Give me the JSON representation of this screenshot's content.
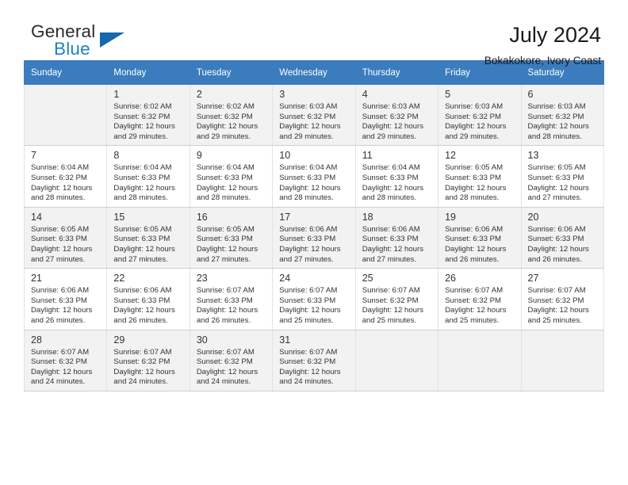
{
  "brand": {
    "name_top": "General",
    "name_bottom": "Blue",
    "accent_color": "#1f7fc4",
    "triangle_color": "#1667ad"
  },
  "header": {
    "title": "July 2024",
    "subtitle": "Bokakokore, Ivory Coast"
  },
  "calendar": {
    "header_bg": "#3a7cbe",
    "header_text_color": "#ffffff",
    "weekdays": [
      "Sunday",
      "Monday",
      "Tuesday",
      "Wednesday",
      "Thursday",
      "Friday",
      "Saturday"
    ],
    "weeks": [
      {
        "shaded": true,
        "days": [
          {
            "num": "",
            "lines": []
          },
          {
            "num": "1",
            "lines": [
              "Sunrise: 6:02 AM",
              "Sunset: 6:32 PM",
              "Daylight: 12 hours",
              "and 29 minutes."
            ]
          },
          {
            "num": "2",
            "lines": [
              "Sunrise: 6:02 AM",
              "Sunset: 6:32 PM",
              "Daylight: 12 hours",
              "and 29 minutes."
            ]
          },
          {
            "num": "3",
            "lines": [
              "Sunrise: 6:03 AM",
              "Sunset: 6:32 PM",
              "Daylight: 12 hours",
              "and 29 minutes."
            ]
          },
          {
            "num": "4",
            "lines": [
              "Sunrise: 6:03 AM",
              "Sunset: 6:32 PM",
              "Daylight: 12 hours",
              "and 29 minutes."
            ]
          },
          {
            "num": "5",
            "lines": [
              "Sunrise: 6:03 AM",
              "Sunset: 6:32 PM",
              "Daylight: 12 hours",
              "and 29 minutes."
            ]
          },
          {
            "num": "6",
            "lines": [
              "Sunrise: 6:03 AM",
              "Sunset: 6:32 PM",
              "Daylight: 12 hours",
              "and 28 minutes."
            ]
          }
        ]
      },
      {
        "shaded": false,
        "days": [
          {
            "num": "7",
            "lines": [
              "Sunrise: 6:04 AM",
              "Sunset: 6:32 PM",
              "Daylight: 12 hours",
              "and 28 minutes."
            ]
          },
          {
            "num": "8",
            "lines": [
              "Sunrise: 6:04 AM",
              "Sunset: 6:33 PM",
              "Daylight: 12 hours",
              "and 28 minutes."
            ]
          },
          {
            "num": "9",
            "lines": [
              "Sunrise: 6:04 AM",
              "Sunset: 6:33 PM",
              "Daylight: 12 hours",
              "and 28 minutes."
            ]
          },
          {
            "num": "10",
            "lines": [
              "Sunrise: 6:04 AM",
              "Sunset: 6:33 PM",
              "Daylight: 12 hours",
              "and 28 minutes."
            ]
          },
          {
            "num": "11",
            "lines": [
              "Sunrise: 6:04 AM",
              "Sunset: 6:33 PM",
              "Daylight: 12 hours",
              "and 28 minutes."
            ]
          },
          {
            "num": "12",
            "lines": [
              "Sunrise: 6:05 AM",
              "Sunset: 6:33 PM",
              "Daylight: 12 hours",
              "and 28 minutes."
            ]
          },
          {
            "num": "13",
            "lines": [
              "Sunrise: 6:05 AM",
              "Sunset: 6:33 PM",
              "Daylight: 12 hours",
              "and 27 minutes."
            ]
          }
        ]
      },
      {
        "shaded": true,
        "days": [
          {
            "num": "14",
            "lines": [
              "Sunrise: 6:05 AM",
              "Sunset: 6:33 PM",
              "Daylight: 12 hours",
              "and 27 minutes."
            ]
          },
          {
            "num": "15",
            "lines": [
              "Sunrise: 6:05 AM",
              "Sunset: 6:33 PM",
              "Daylight: 12 hours",
              "and 27 minutes."
            ]
          },
          {
            "num": "16",
            "lines": [
              "Sunrise: 6:05 AM",
              "Sunset: 6:33 PM",
              "Daylight: 12 hours",
              "and 27 minutes."
            ]
          },
          {
            "num": "17",
            "lines": [
              "Sunrise: 6:06 AM",
              "Sunset: 6:33 PM",
              "Daylight: 12 hours",
              "and 27 minutes."
            ]
          },
          {
            "num": "18",
            "lines": [
              "Sunrise: 6:06 AM",
              "Sunset: 6:33 PM",
              "Daylight: 12 hours",
              "and 27 minutes."
            ]
          },
          {
            "num": "19",
            "lines": [
              "Sunrise: 6:06 AM",
              "Sunset: 6:33 PM",
              "Daylight: 12 hours",
              "and 26 minutes."
            ]
          },
          {
            "num": "20",
            "lines": [
              "Sunrise: 6:06 AM",
              "Sunset: 6:33 PM",
              "Daylight: 12 hours",
              "and 26 minutes."
            ]
          }
        ]
      },
      {
        "shaded": false,
        "days": [
          {
            "num": "21",
            "lines": [
              "Sunrise: 6:06 AM",
              "Sunset: 6:33 PM",
              "Daylight: 12 hours",
              "and 26 minutes."
            ]
          },
          {
            "num": "22",
            "lines": [
              "Sunrise: 6:06 AM",
              "Sunset: 6:33 PM",
              "Daylight: 12 hours",
              "and 26 minutes."
            ]
          },
          {
            "num": "23",
            "lines": [
              "Sunrise: 6:07 AM",
              "Sunset: 6:33 PM",
              "Daylight: 12 hours",
              "and 26 minutes."
            ]
          },
          {
            "num": "24",
            "lines": [
              "Sunrise: 6:07 AM",
              "Sunset: 6:33 PM",
              "Daylight: 12 hours",
              "and 25 minutes."
            ]
          },
          {
            "num": "25",
            "lines": [
              "Sunrise: 6:07 AM",
              "Sunset: 6:32 PM",
              "Daylight: 12 hours",
              "and 25 minutes."
            ]
          },
          {
            "num": "26",
            "lines": [
              "Sunrise: 6:07 AM",
              "Sunset: 6:32 PM",
              "Daylight: 12 hours",
              "and 25 minutes."
            ]
          },
          {
            "num": "27",
            "lines": [
              "Sunrise: 6:07 AM",
              "Sunset: 6:32 PM",
              "Daylight: 12 hours",
              "and 25 minutes."
            ]
          }
        ]
      },
      {
        "shaded": true,
        "days": [
          {
            "num": "28",
            "lines": [
              "Sunrise: 6:07 AM",
              "Sunset: 6:32 PM",
              "Daylight: 12 hours",
              "and 24 minutes."
            ]
          },
          {
            "num": "29",
            "lines": [
              "Sunrise: 6:07 AM",
              "Sunset: 6:32 PM",
              "Daylight: 12 hours",
              "and 24 minutes."
            ]
          },
          {
            "num": "30",
            "lines": [
              "Sunrise: 6:07 AM",
              "Sunset: 6:32 PM",
              "Daylight: 12 hours",
              "and 24 minutes."
            ]
          },
          {
            "num": "31",
            "lines": [
              "Sunrise: 6:07 AM",
              "Sunset: 6:32 PM",
              "Daylight: 12 hours",
              "and 24 minutes."
            ]
          },
          {
            "num": "",
            "lines": []
          },
          {
            "num": "",
            "lines": []
          },
          {
            "num": "",
            "lines": []
          }
        ]
      }
    ]
  }
}
